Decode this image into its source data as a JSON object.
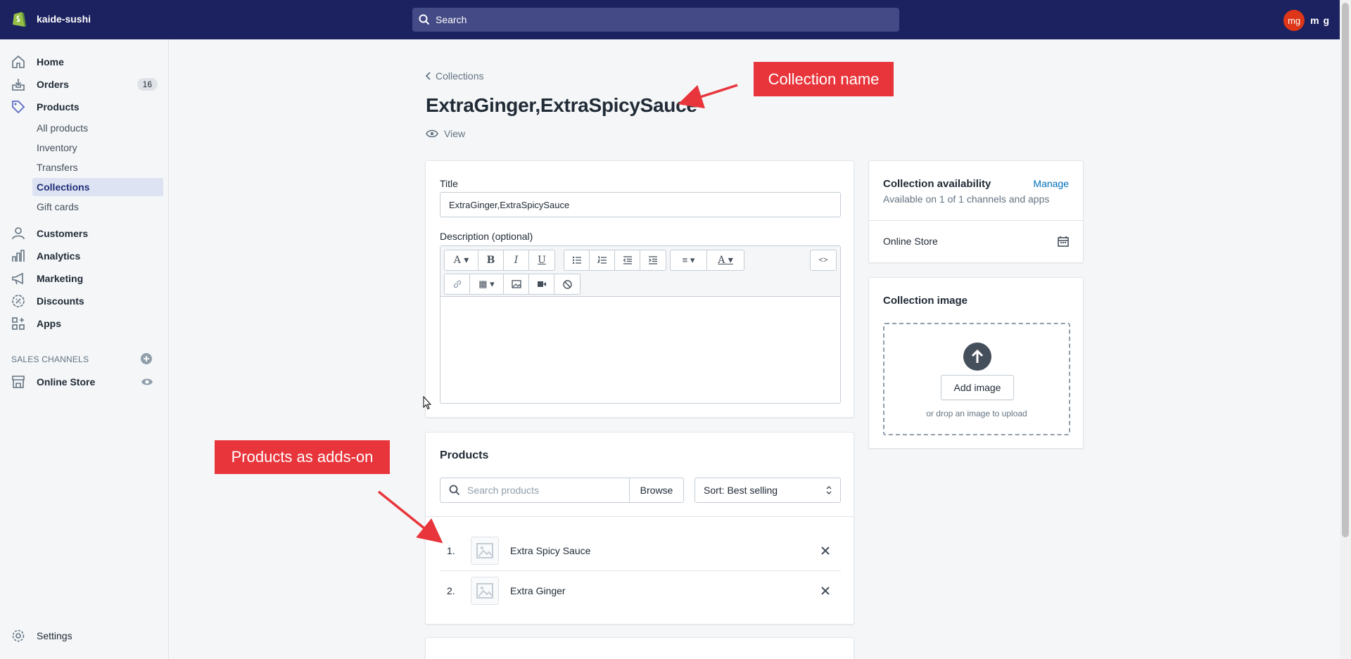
{
  "topbar": {
    "store_name": "kaide-sushi",
    "search_placeholder": "Search",
    "user_initials": "mg",
    "user_name": "m g",
    "bar_color": "#1c2260",
    "avatar_color": "#de3618"
  },
  "sidebar": {
    "nav": [
      {
        "label": "Home",
        "icon": "home-icon"
      },
      {
        "label": "Orders",
        "icon": "orders-icon",
        "badge": "16"
      },
      {
        "label": "Products",
        "icon": "tag-icon"
      },
      {
        "label": "Customers",
        "icon": "person-icon"
      },
      {
        "label": "Analytics",
        "icon": "bar-chart-icon"
      },
      {
        "label": "Marketing",
        "icon": "megaphone-icon"
      },
      {
        "label": "Discounts",
        "icon": "discount-icon"
      },
      {
        "label": "Apps",
        "icon": "apps-icon"
      }
    ],
    "products_sub": [
      {
        "label": "All products"
      },
      {
        "label": "Inventory"
      },
      {
        "label": "Transfers"
      },
      {
        "label": "Collections",
        "active": true
      },
      {
        "label": "Gift cards"
      }
    ],
    "sales_channels_heading": "SALES CHANNELS",
    "online_store": "Online Store",
    "settings": "Settings"
  },
  "page": {
    "breadcrumb": "Collections",
    "title": "ExtraGinger,ExtraSpicySauce",
    "view_label": "View"
  },
  "title_card": {
    "title_label": "Title",
    "title_value": "ExtraGinger,ExtraSpicySauce",
    "description_label": "Description (optional)"
  },
  "products_card": {
    "heading": "Products",
    "search_placeholder": "Search products",
    "browse_label": "Browse",
    "sort_label": "Sort: Best selling",
    "items": [
      {
        "num": "1.",
        "name": "Extra Spicy Sauce"
      },
      {
        "num": "2.",
        "name": "Extra Ginger"
      }
    ]
  },
  "availability_card": {
    "heading": "Collection availability",
    "manage_label": "Manage",
    "subtitle": "Available on 1 of 1 channels and apps",
    "channel": "Online Store"
  },
  "image_card": {
    "heading": "Collection image",
    "add_image_label": "Add image",
    "drop_hint": "or drop an image to upload"
  },
  "annotations": {
    "collection_name": "Collection name",
    "products_addons": "Products as adds-on",
    "callout_color": "#e8353b"
  }
}
